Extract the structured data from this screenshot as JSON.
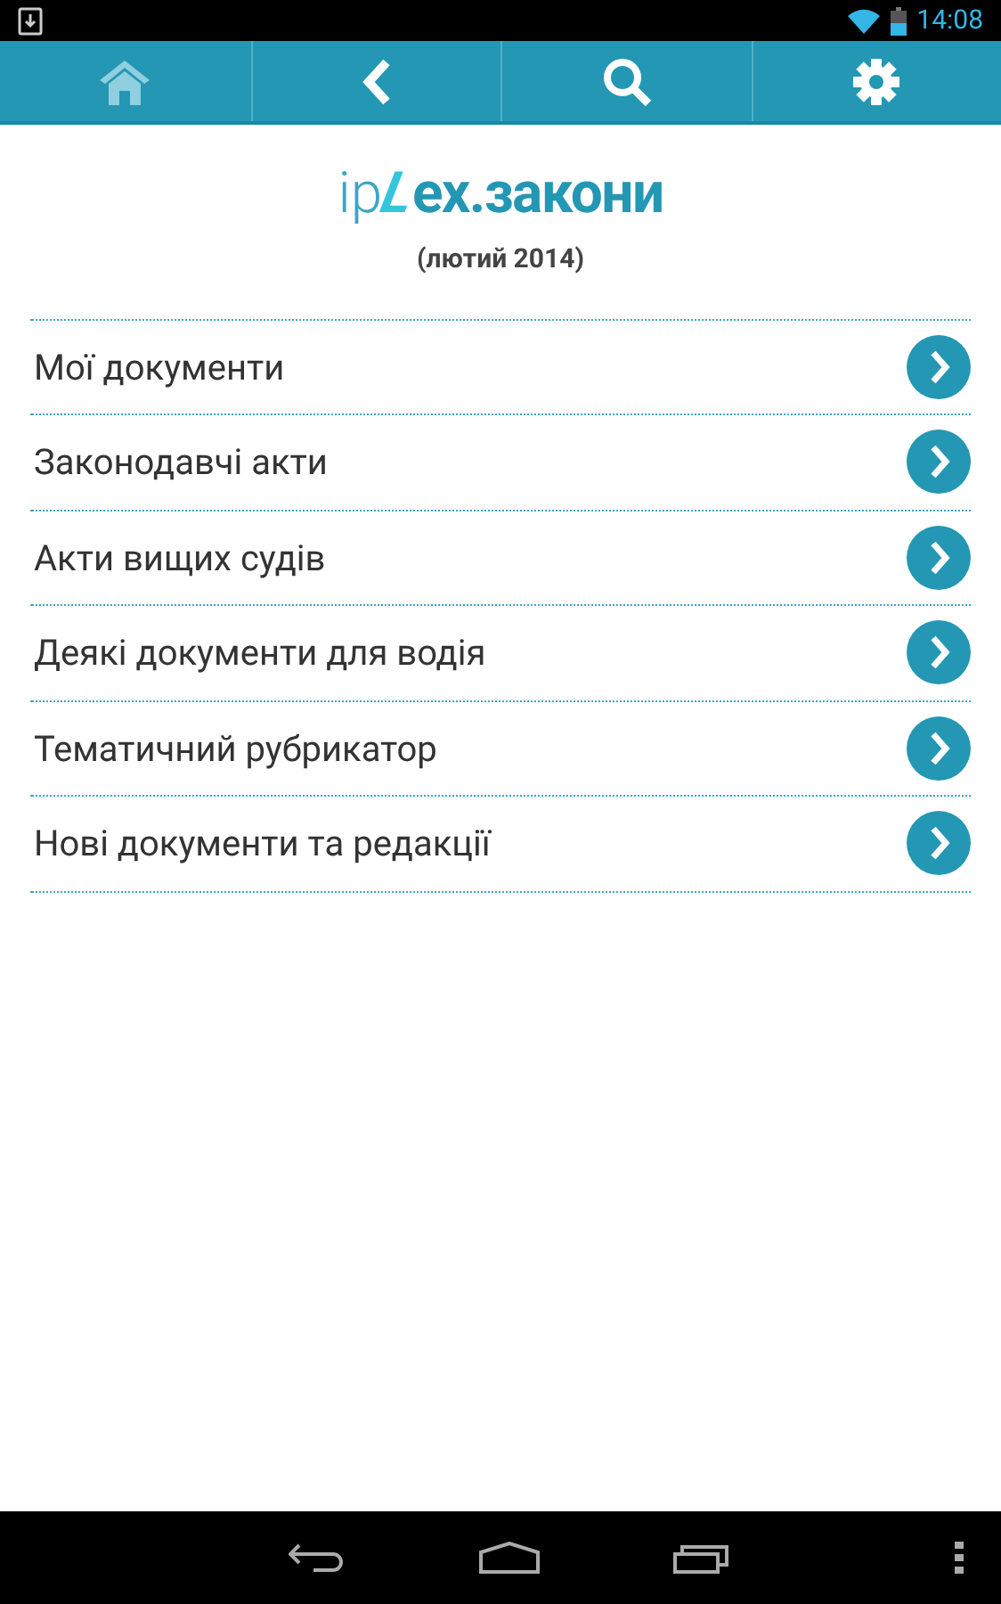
{
  "status_bar": {
    "time": "14:08"
  },
  "toolbar": [
    {
      "kind": "home",
      "disabled": true
    },
    {
      "kind": "back",
      "disabled": false
    },
    {
      "kind": "search",
      "disabled": false
    },
    {
      "kind": "settings",
      "disabled": false
    }
  ],
  "logo": {
    "prefix": "ip",
    "letter": "L",
    "name": "ex.закони"
  },
  "edition": "(лютий 2014)",
  "menu": [
    {
      "label": "Мої документи"
    },
    {
      "label": "Законодавчі акти"
    },
    {
      "label": "Акти вищих судів"
    },
    {
      "label": "Деякі документи для водія"
    },
    {
      "label": "Тематичний рубрикатор"
    },
    {
      "label": "Нові документи та редакції"
    }
  ]
}
